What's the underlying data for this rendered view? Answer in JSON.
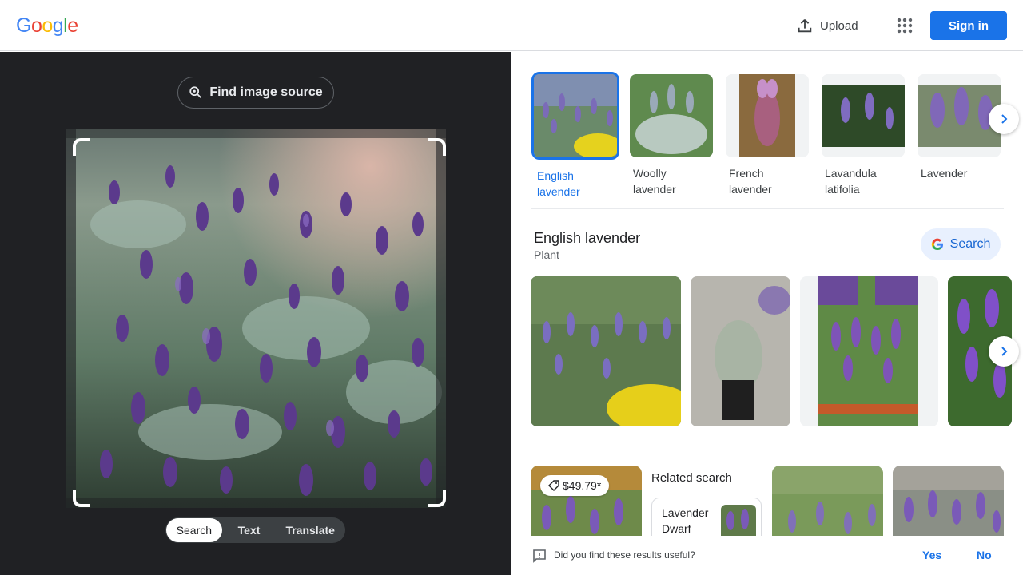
{
  "header": {
    "logo_letters": [
      "G",
      "o",
      "o",
      "g",
      "l",
      "e"
    ],
    "logo_colors": [
      "#4285f4",
      "#ea4335",
      "#fbbc05",
      "#4285f4",
      "#34a853",
      "#ea4335"
    ],
    "upload_label": "Upload",
    "signin_label": "Sign in"
  },
  "lens": {
    "find_source_label": "Find image source",
    "modes": [
      {
        "label": "Search",
        "active": true
      },
      {
        "label": "Text",
        "active": false
      },
      {
        "label": "Translate",
        "active": false
      }
    ]
  },
  "results": {
    "thumbnails": [
      {
        "label": "English lavender",
        "active": true
      },
      {
        "label": "Woolly lavender",
        "active": false
      },
      {
        "label": "French lavender",
        "active": false
      },
      {
        "label": "Lavandula latifolia",
        "active": false
      },
      {
        "label": "Lavender",
        "active": false
      }
    ],
    "entity": {
      "title": "English lavender",
      "subtitle": "Plant",
      "search_label": "Search"
    },
    "shopping": {
      "price": "$49.79*"
    },
    "related": {
      "title": "Related search",
      "chip_label": "Lavender Dwarf"
    }
  },
  "feedback": {
    "question": "Did you find these results useful?",
    "yes_label": "Yes",
    "no_label": "No"
  },
  "colors": {
    "accent": "#1a73e8",
    "dark_panel": "#202124"
  }
}
